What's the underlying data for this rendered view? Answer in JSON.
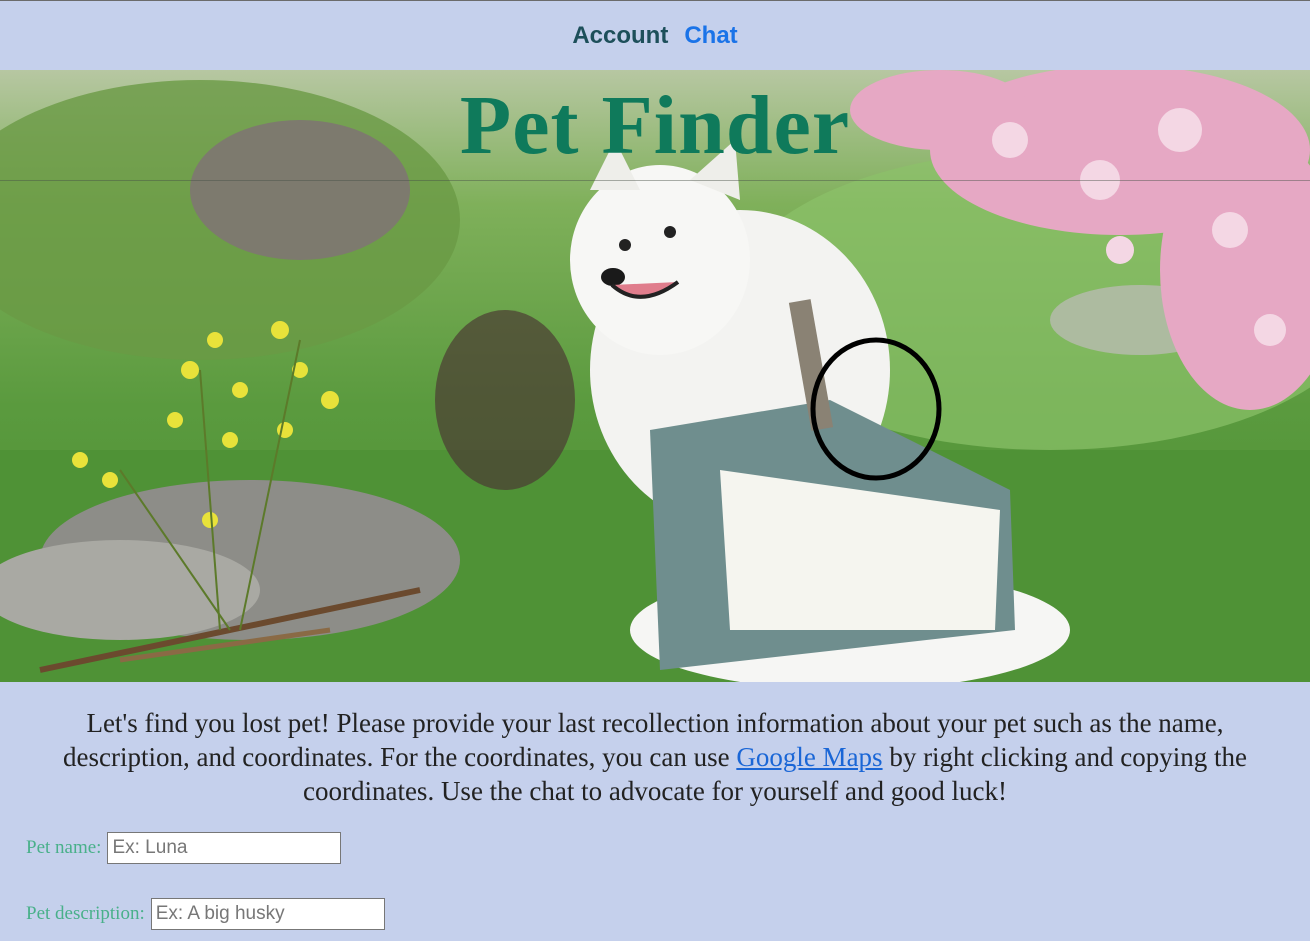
{
  "nav": {
    "account_label": "Account",
    "chat_label": "Chat"
  },
  "hero": {
    "title": "Pet Finder"
  },
  "intro": {
    "text_before": "Let's find you lost pet! Please provide your last recollection information about your pet such as the name, description, and coordinates. For the coordinates, you can use ",
    "link_label": "Google Maps",
    "text_after": " by right clicking and copying the coordinates. Use the chat to advocate for yourself and good luck!"
  },
  "form": {
    "name_label": "Pet name:",
    "name_placeholder": "Ex: Luna",
    "description_label": "Pet description:",
    "description_placeholder": "Ex: A big husky"
  },
  "colors": {
    "background": "#c5d0ec",
    "title": "#0f7a5b",
    "form_label": "#49b08a",
    "link": "#1a66d6"
  }
}
